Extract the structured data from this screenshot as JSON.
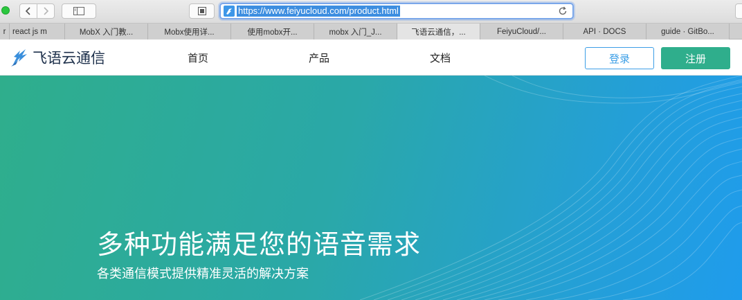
{
  "browser": {
    "url": "https://www.feiyucloud.com/product.html",
    "tabs": [
      {
        "label": "r"
      },
      {
        "label": "react js m"
      },
      {
        "label": "MobX 入门教..."
      },
      {
        "label": "Mobx使用详..."
      },
      {
        "label": "使用mobx开..."
      },
      {
        "label": "mobx 入门_J..."
      },
      {
        "label": "飞语云通信，..."
      },
      {
        "label": "FeiyuCloud/..."
      },
      {
        "label": "API · DOCS"
      },
      {
        "label": "guide · GitBo..."
      }
    ],
    "active_tab": 6
  },
  "site": {
    "logo_text": "飞语云通信",
    "nav": [
      "首页",
      "产品",
      "文档"
    ],
    "login_label": "登录",
    "register_label": "注册",
    "colors": {
      "primary_green": "#2fae8c",
      "primary_blue": "#3b9ee6"
    }
  },
  "hero": {
    "title": "多种功能满足您的语音需求",
    "subtitle": "各类通信模式提供精准灵活的解决方案"
  }
}
